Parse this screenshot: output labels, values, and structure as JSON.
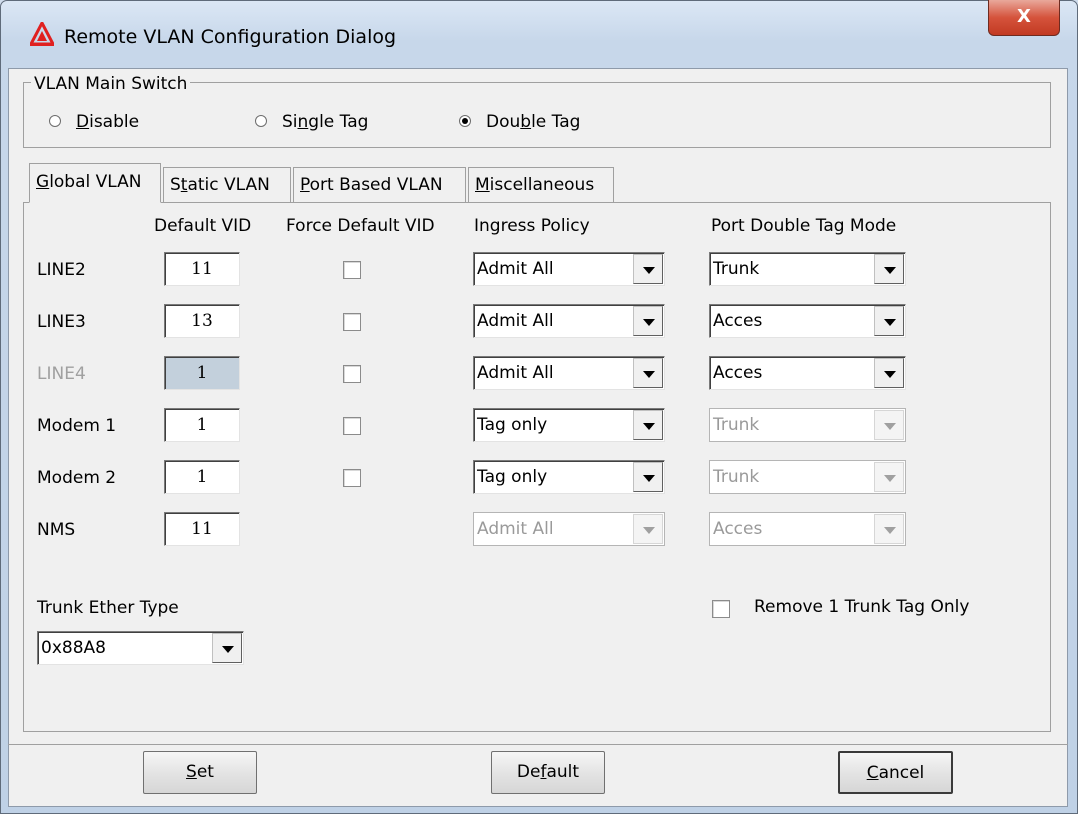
{
  "window": {
    "title": "Remote VLAN Configuration Dialog",
    "close_glyph": "X"
  },
  "main_switch": {
    "legend": "VLAN Main Switch",
    "options": [
      {
        "pre": "",
        "ul": "D",
        "post": "isable",
        "selected": false
      },
      {
        "pre": "Si",
        "ul": "n",
        "post": "gle Tag",
        "selected": false
      },
      {
        "pre": "Dou",
        "ul": "b",
        "post": "le Tag",
        "selected": true
      }
    ]
  },
  "tabs": [
    {
      "pre": "",
      "ul": "G",
      "post": "lobal VLAN",
      "active": true
    },
    {
      "pre": "S",
      "ul": "t",
      "post": "atic VLAN",
      "active": false
    },
    {
      "pre": "",
      "ul": "P",
      "post": "ort Based VLAN",
      "active": false
    },
    {
      "pre": "",
      "ul": "M",
      "post": "iscellaneous",
      "active": false
    }
  ],
  "columns": {
    "default_vid": "Default VID",
    "force_default_vid": "Force Default VID",
    "ingress_policy": "Ingress Policy",
    "port_double_tag_mode": "Port Double Tag Mode"
  },
  "rows": [
    {
      "label": "LINE2",
      "vid": "11",
      "ingress": "Admit All",
      "mode": "Trunk"
    },
    {
      "label": "LINE3",
      "vid": "13",
      "ingress": "Admit All",
      "mode": "Acces"
    },
    {
      "label": "LINE4",
      "vid": "1",
      "ingress": "Admit All",
      "mode": "Acces"
    },
    {
      "label": "Modem 1",
      "vid": "1",
      "ingress": "Tag only",
      "mode": "Trunk"
    },
    {
      "label": "Modem 2",
      "vid": "1",
      "ingress": "Tag only",
      "mode": "Trunk"
    },
    {
      "label": "NMS",
      "vid": "11",
      "ingress": "Admit All",
      "mode": "Acces"
    }
  ],
  "trunk": {
    "label": "Trunk Ether Type",
    "value": "0x88A8"
  },
  "remove_trunk": {
    "label": "Remove 1 Trunk Tag Only"
  },
  "buttons": {
    "set": {
      "ul": "S",
      "post": "et"
    },
    "default": {
      "pre": "De",
      "ul": "f",
      "post": "ault"
    },
    "cancel": {
      "ul": "C",
      "post": "ancel"
    }
  },
  "colors": {
    "title_bar": "#cfdcec",
    "client": "#f0f0f0",
    "disabled_field": "#c3d0dc",
    "close_button": "#d5533c"
  }
}
